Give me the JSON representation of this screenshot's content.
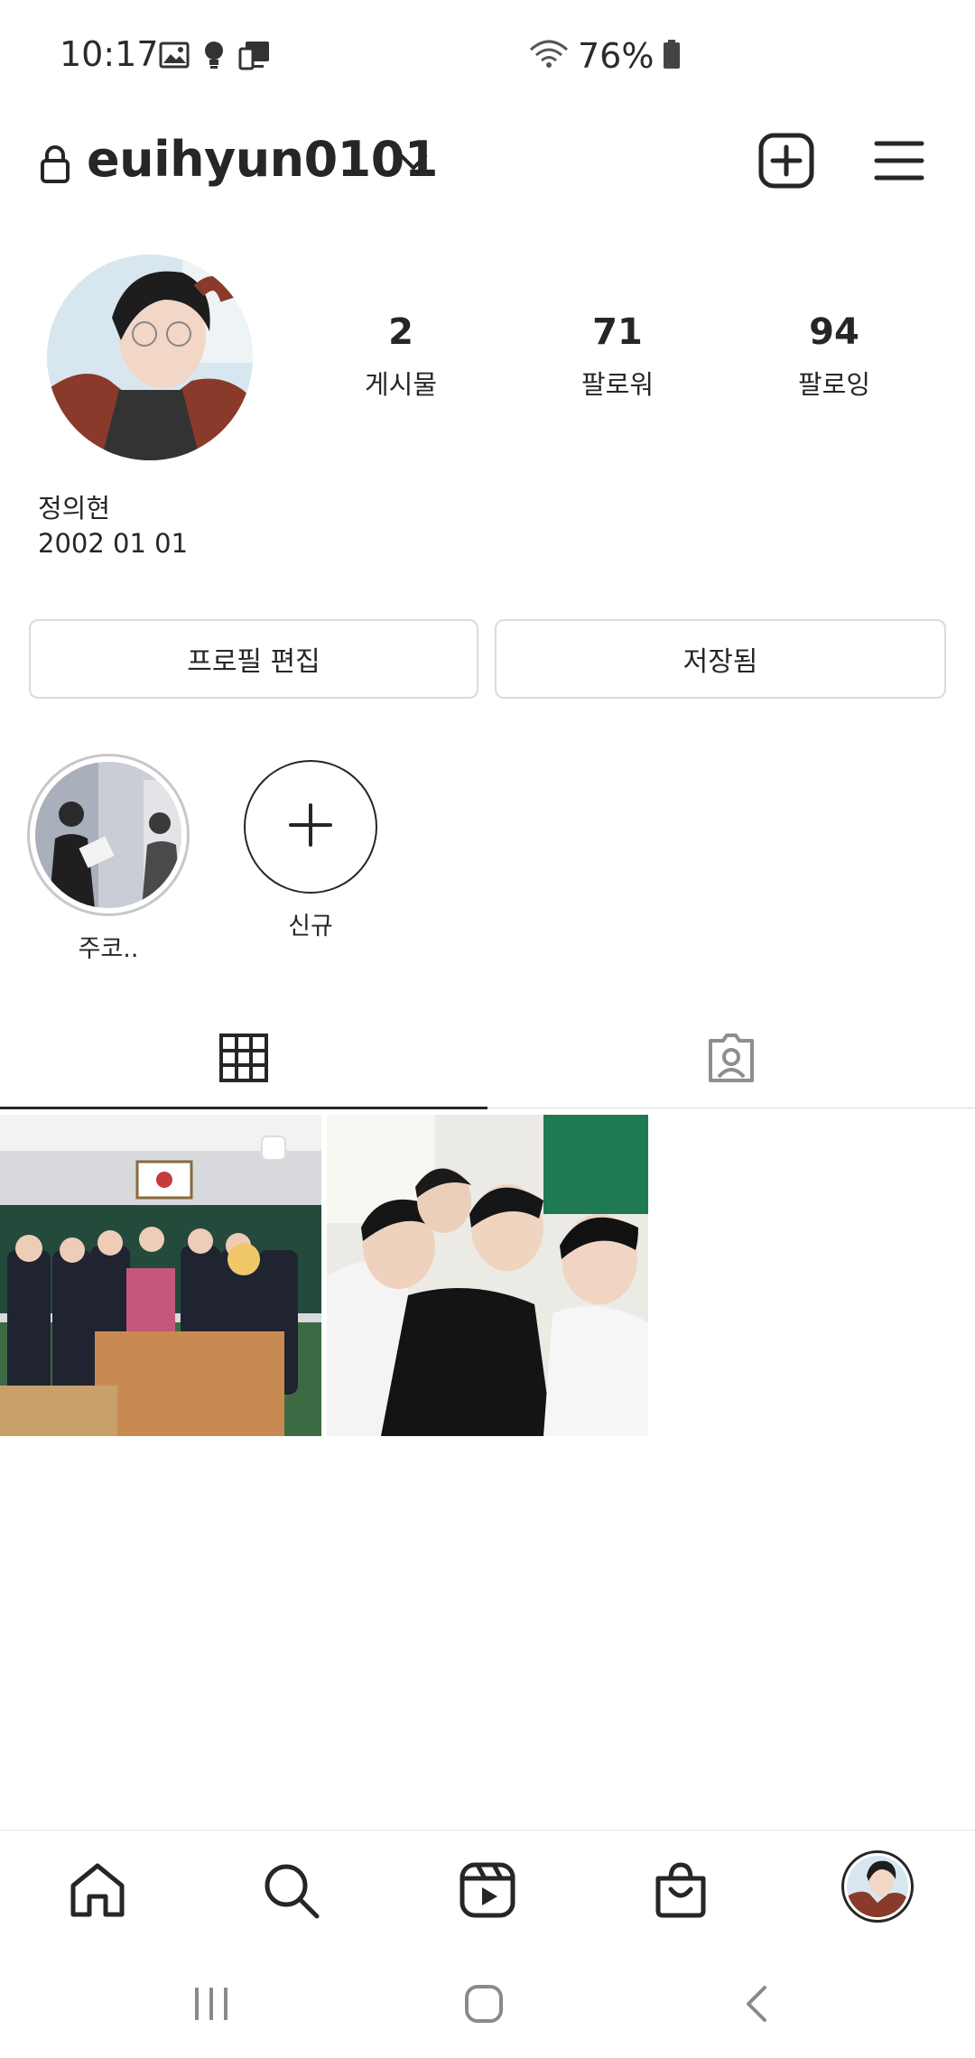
{
  "status_bar": {
    "time": "10:17",
    "battery_percent": "76%",
    "icons_left": [
      "gallery-icon",
      "bulb-icon",
      "device-icon"
    ],
    "icons_right": [
      "wifi-icon",
      "battery-icon"
    ]
  },
  "header": {
    "username": "euihyun0101",
    "icons": [
      "lock-icon",
      "chevron-down-icon",
      "add-post-icon",
      "menu-icon"
    ]
  },
  "profile": {
    "stats": [
      {
        "value": "2",
        "label": "게시물"
      },
      {
        "value": "71",
        "label": "팔로워"
      },
      {
        "value": "94",
        "label": "팔로잉"
      }
    ],
    "name": "정의현",
    "bio": "2002 01 01"
  },
  "buttons": {
    "edit_profile": "프로필 편집",
    "saved": "저장됨"
  },
  "highlights": [
    {
      "label": "주코.."
    },
    {
      "label": "신규"
    }
  ],
  "tabs": [
    "grid-icon",
    "tagged-icon"
  ],
  "bottom_nav": [
    "home-icon",
    "search-icon",
    "reels-icon",
    "shop-icon",
    "profile-avatar"
  ],
  "system_nav": [
    "recents-icon",
    "home-button-icon",
    "back-icon"
  ],
  "colors": {
    "text": "#262626",
    "border": "#dbdbdb",
    "secondary": "#8e8e8e"
  }
}
